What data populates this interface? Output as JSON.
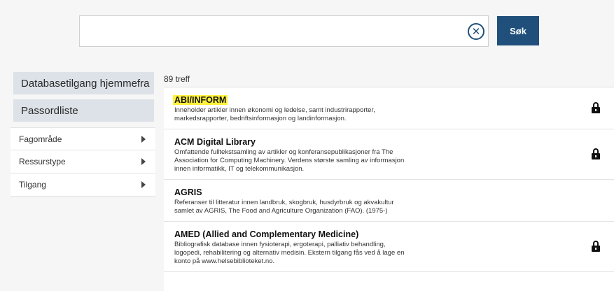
{
  "search": {
    "value": "",
    "clear_icon": "✕",
    "button_label": "Søk"
  },
  "sidebar": {
    "buttons": [
      {
        "label": "Databasetilgang hjemmefra"
      },
      {
        "label": "Passordliste"
      }
    ],
    "filters": [
      {
        "label": "Fagområde"
      },
      {
        "label": "Ressurstype"
      },
      {
        "label": "Tilgang"
      }
    ]
  },
  "results": {
    "count_label": "89 treff",
    "items": [
      {
        "title": "ABI/INFORM",
        "highlighted": true,
        "description": "Inneholder artikler innen økonomi og ledelse, samt industrirapporter, markedsrapporter, bedriftsinformasjon og landinformasjon.",
        "locked": true
      },
      {
        "title": "ACM Digital Library",
        "highlighted": false,
        "description": "Omfattende fulltekstsamling av artikler og konferansepublikasjoner fra The Association for Computing Machinery. Verdens største samling av informasjon innen informatikk, IT og telekommunikasjon.",
        "locked": true
      },
      {
        "title": "AGRIS",
        "highlighted": false,
        "description": "Referanser til litteratur innen landbruk, skogbruk, husdyrbruk og akvakultur samlet av AGRIS, The Food and Agriculture Organization (FAO). (1975-)",
        "locked": false
      },
      {
        "title": "AMED (Allied and Complementary Medicine)",
        "highlighted": false,
        "description": "Bibliografisk database innen fysioterapi, ergoterapi, palliativ behandling, logopedi, rehabilitering og alternativ medisin. Ekstern tilgang fås ved å lage en konto på www.helsebiblioteket.no.",
        "locked": true
      }
    ]
  },
  "colors": {
    "primary": "#1f4f7a",
    "highlight": "#fff23b",
    "sidebar_button": "#dde2e8"
  }
}
